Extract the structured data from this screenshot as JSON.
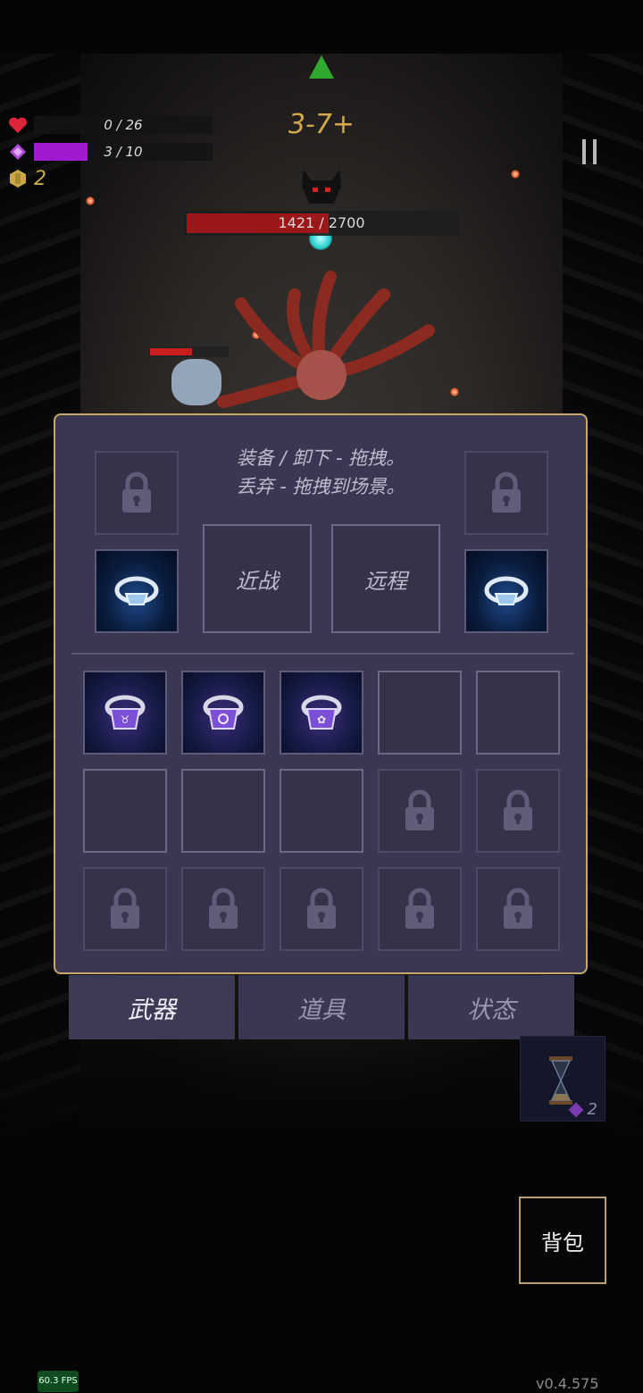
{
  "hud": {
    "hp_text": "0 / 26",
    "hp_fraction": 0,
    "mana_text": "3 / 10",
    "mana_fraction": 0.3,
    "gold_value": "2",
    "level_text": "3-7+",
    "boss_hp_text": "1421 / 2700",
    "boss_hp_fraction": 0.526,
    "enemy_hp_fraction": 0.55,
    "icons": {
      "hp": "heart-icon",
      "mana": "crystal-icon",
      "gold": "coin-icon",
      "pause": "pause-icon",
      "boss": "demon-skull-icon"
    }
  },
  "panel": {
    "hint_line1": "装备 / 卸下 - 拖拽。",
    "hint_line2": "丢弃 - 拖拽到场景。",
    "melee_label": "近战",
    "ranged_label": "远程",
    "equip_slots": [
      "locked",
      "locked",
      "ring-blue",
      "ring-blue"
    ],
    "inventory": [
      [
        "ring-purple",
        "ring-purple",
        "ring-purple",
        "empty",
        "empty"
      ],
      [
        "empty",
        "empty",
        "empty",
        "locked",
        "locked"
      ],
      [
        "locked",
        "locked",
        "locked",
        "locked",
        "locked"
      ]
    ]
  },
  "tabs": [
    {
      "label": "武器",
      "active": true
    },
    {
      "label": "道具",
      "active": false
    },
    {
      "label": "状态",
      "active": false
    }
  ],
  "side_card": {
    "count": "2",
    "icon": "hourglass-icon"
  },
  "bag_button": {
    "label": "背包"
  },
  "footer": {
    "fps": "60.3 FPS",
    "version": "v0.4.575"
  },
  "colors": {
    "panel_bg": "#3a3752",
    "panel_border": "#c9a76a",
    "mana": "#a11ad0",
    "boss_hp": "#9c1818",
    "level_text": "#d4a94c"
  }
}
